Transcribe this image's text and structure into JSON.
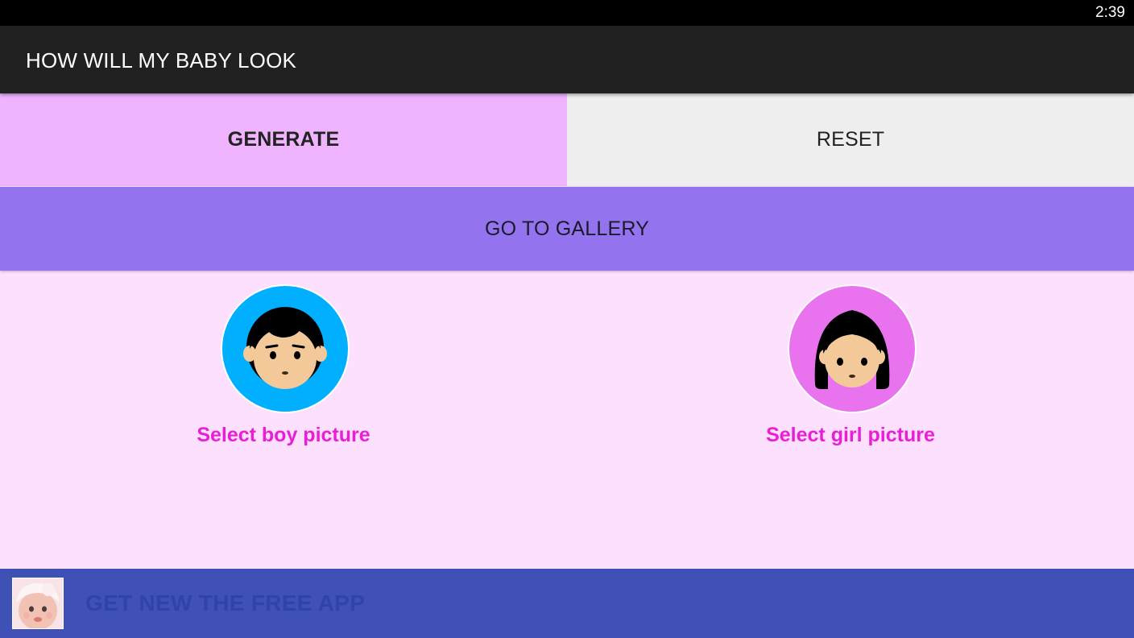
{
  "status_bar": {
    "time": "2:39"
  },
  "app_bar": {
    "title": "HOW WILL MY BABY LOOK",
    "star_icon": "star-icon"
  },
  "actions": {
    "generate_label": "GENERATE",
    "reset_label": "RESET",
    "gallery_label": "GO TO GALLERY"
  },
  "selectors": {
    "boy_label": "Select boy picture",
    "girl_label": "Select girl picture",
    "boy_icon": "boy-face-icon",
    "girl_icon": "girl-face-icon"
  },
  "ad": {
    "text": "GET NEW THE FREE APP",
    "thumb_icon": "baby-photo-icon"
  },
  "colors": {
    "app_bar": "#212121",
    "generate_bg": "#efb4fd",
    "reset_bg": "#eeeeee",
    "gallery_bg": "#9474ee",
    "content_bg": "#fde0fd",
    "label_text": "#e91fd8",
    "boy_circle": "#00b0ff",
    "girl_circle": "#e973ee",
    "ad_bg": "#3f51b5"
  }
}
